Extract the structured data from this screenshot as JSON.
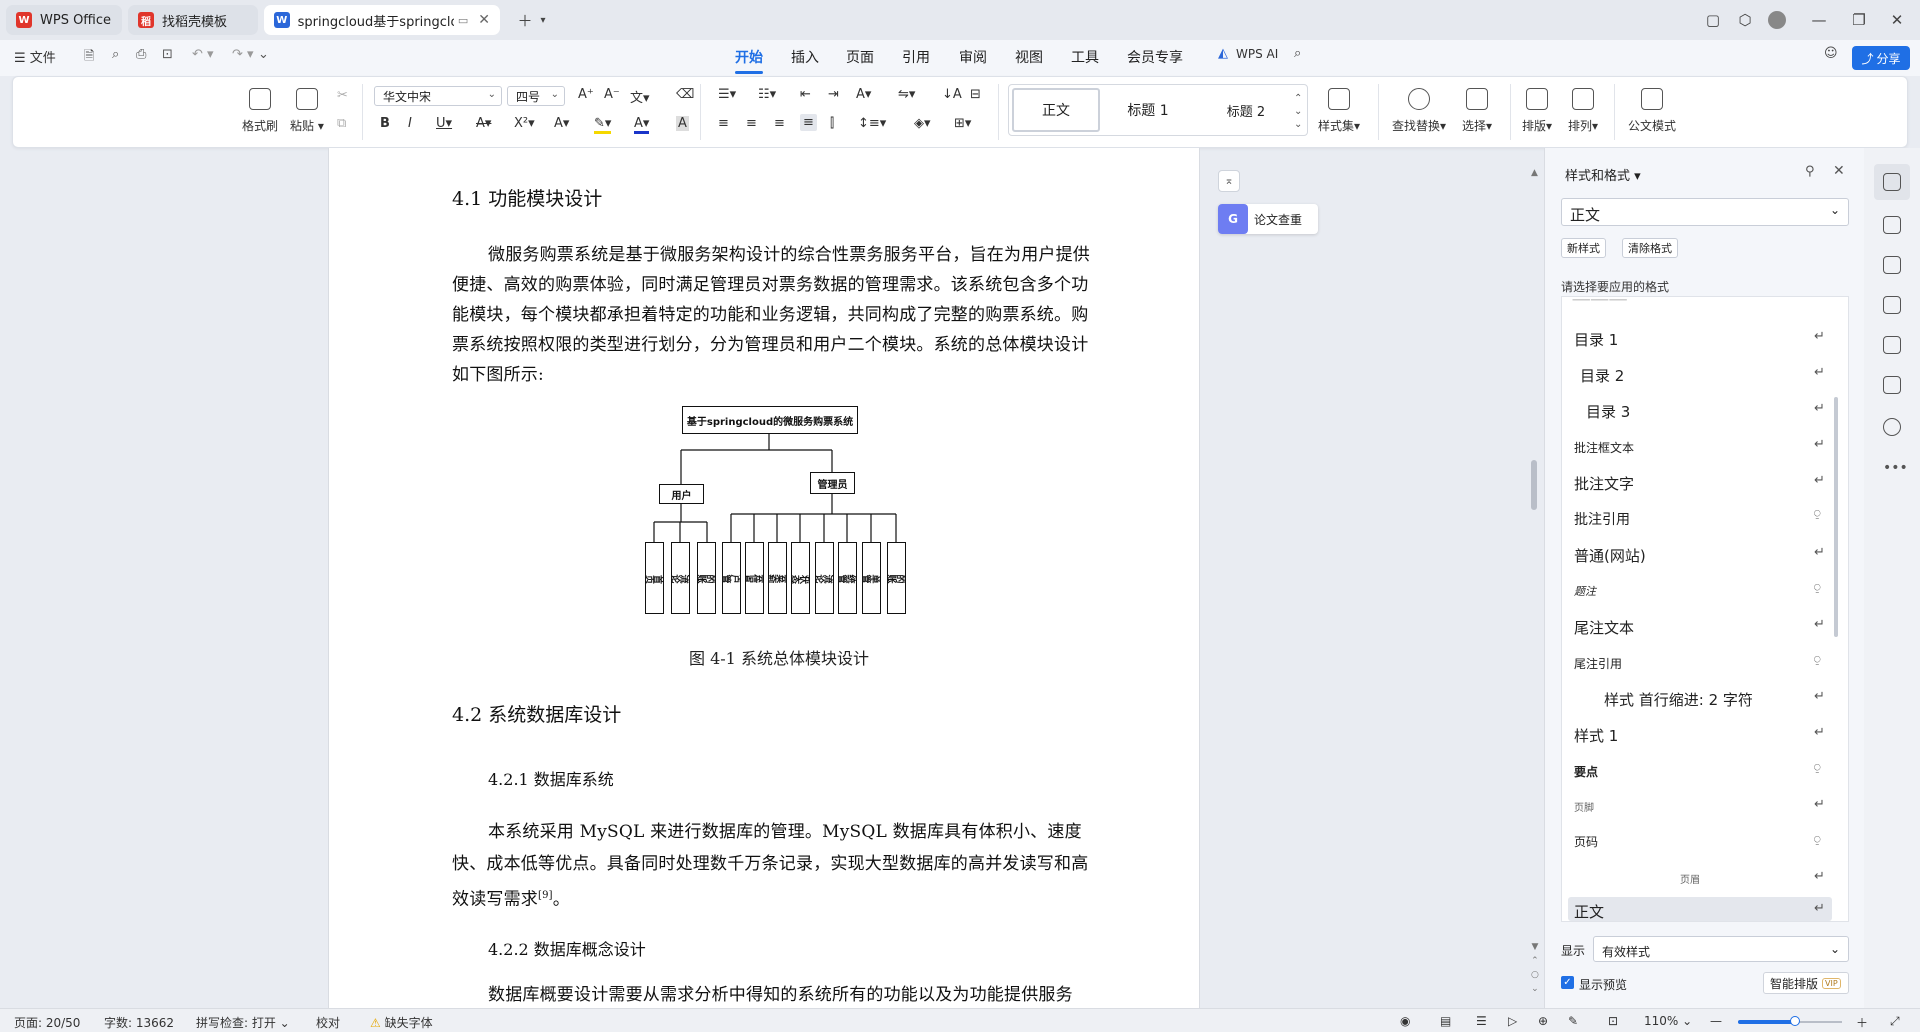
{
  "tabs": [
    {
      "label": "WPS Office",
      "icon": "wps-logo-icon"
    },
    {
      "label": "找稻壳模板",
      "icon": "docer-icon"
    },
    {
      "label": "springcloud基于springcloud",
      "icon": "word-doc-icon",
      "active": true
    }
  ],
  "menubar": {
    "file": "文件",
    "items": [
      "开始",
      "插入",
      "页面",
      "引用",
      "审阅",
      "视图",
      "工具",
      "会员专享"
    ],
    "active": "开始",
    "wps_ai": "WPS AI",
    "share": "分享"
  },
  "ribbon": {
    "format_painter": "格式刷",
    "paste": "粘贴",
    "font_name": "华文中宋",
    "font_size": "四号",
    "styles": [
      "正文",
      "标题 1",
      "标题 2"
    ],
    "style_set": "样式集",
    "find_replace": "查找替换",
    "select": "选择",
    "layout": "排版",
    "arrange": "排列",
    "doc_format": "公文模式"
  },
  "document": {
    "h41": "4.1 功能模块设计",
    "p1": "微服务购票系统是基于微服务架构设计的综合性票务服务平台，旨在为用户提供便捷、高效的购票体验，同时满足管理员对票务数据的管理需求。该系统包含多个功能模块，每个模块都承担着特定的功能和业务逻辑，共同构成了完整的购票系统。购票系统按照权限的类型进行划分，分为管理员和用户二个模块。系统的总体模块设计如下图所示:",
    "diagram": {
      "root": "基于springcloud的微服务购票系统",
      "user": "用户",
      "admin": "管理员",
      "user_modules": [
        "首页",
        "交流论坛",
        "我的账户"
      ],
      "admin_modules": [
        "用户管理",
        "演唱会信息管理",
        "演唱会类型管理",
        "门票状态管理",
        "交流论坛",
        "系统管理",
        "订单管理",
        "我的账户"
      ]
    },
    "caption": "图 4-1  系统总体模块设计",
    "h42": "4.2 系统数据库设计",
    "h421": "4.2.1 数据库系统",
    "p2": "本系统采用 MySQL 来进行数据库的管理。MySQL 数据库具有体积小、速度快、成本低等优点。具备同时处理数千万条记录，实现大型数据库的高并发读写和高效读写需求",
    "p2_ref": "[9]",
    "p2_end": "。",
    "h422": "4.2.2 数据库概念设计",
    "p3": "数据库概要设计需要从需求分析中得知的系统所有的功能以及为功能提供服务"
  },
  "paper_check": "论文查重",
  "panel": {
    "title": "样式和格式",
    "current_style": "正文",
    "new_style": "新样式",
    "clear_format": "清除格式",
    "hint": "请选择要应用的格式",
    "styles": [
      "目录 1",
      "目录 2",
      "目录 3",
      "批注框文本",
      "批注文字",
      "批注引用",
      "普通(网站)",
      "题注",
      "尾注文本",
      "尾注引用",
      "样式 首行缩进:  2 字符",
      "样式 1",
      "要点",
      "页脚",
      "页码",
      "页眉",
      "正文"
    ],
    "show_label": "显示",
    "show_value": "有效样式",
    "preview_label": "显示预览",
    "smart_layout": "智能排版",
    "vip": "VIP"
  },
  "status": {
    "page": "页面: 20/50",
    "words": "字数: 13662",
    "spell": "拼写检查: 打开",
    "proof": "校对",
    "missing_font": "缺失字体",
    "zoom": "110%"
  },
  "colors": {
    "accent": "#1f6fe5",
    "wps_red": "#e0352b",
    "tab_bg": "#e6e9ef"
  }
}
